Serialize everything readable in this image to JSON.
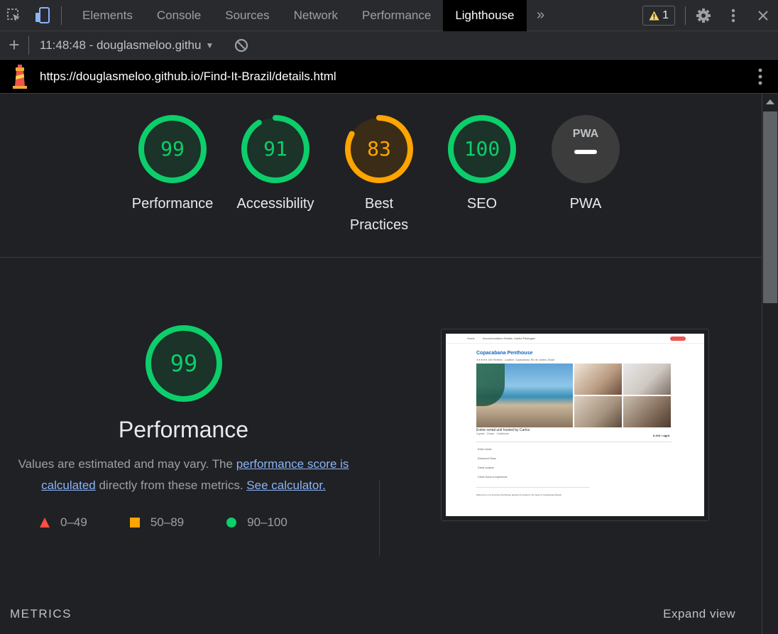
{
  "devtools": {
    "tabs": [
      "Elements",
      "Console",
      "Sources",
      "Network",
      "Performance",
      "Lighthouse"
    ],
    "active_tab": "Lighthouse",
    "warning_count": "1",
    "report_selector": "11:48:48 - douglasmeloo.githu",
    "url": "https://douglasmeloo.github.io/Find-It-Brazil/details.html"
  },
  "scores": [
    {
      "label": "Performance",
      "value": "99",
      "score": 99,
      "rating": "pass"
    },
    {
      "label": "Accessibility",
      "value": "91",
      "score": 91,
      "rating": "pass"
    },
    {
      "label": "Best Practices",
      "value": "83",
      "score": 83,
      "rating": "average"
    },
    {
      "label": "SEO",
      "value": "100",
      "score": 100,
      "rating": "pass"
    },
    {
      "label": "PWA",
      "value": "",
      "score": null,
      "rating": "na"
    }
  ],
  "pwa_badge": "PWA",
  "performance": {
    "score": "99",
    "title": "Performance",
    "desc_prefix": "Values are estimated and may vary. The ",
    "link_score": "performance score is calculated",
    "desc_middle": " directly from these metrics. ",
    "link_calc": "See calculator.",
    "legend": [
      "0–49",
      "50–89",
      "90–100"
    ]
  },
  "screenshot": {
    "nav": [
      "Home",
      "Accommodation Details",
      "Useful Packages"
    ],
    "title": "Copacabana Penthouse",
    "subtitle": "★★★★★ 160 Reviews · Location: Copacabana, Rio de Janeiro, Brazil",
    "caption": "Entire rental unit hosted by Carlos",
    "details": "4 guest · 2 beds · 1 bathroom",
    "price": "$ 200 / night",
    "features": [
      "Entire Home",
      "Enhanced Clean",
      "Great Location",
      "Great Check-in experience"
    ],
    "paragraph": "Welcome to our luxurious Penthouse apartment located in the heart of Copacabana Beach."
  },
  "sections": {
    "metrics": "METRICS",
    "expand": "Expand view"
  },
  "colors": {
    "pass": "#0cce6b",
    "pass_bg": "#1b3328",
    "average": "#ffa400",
    "average_bg": "#3a2c17",
    "fail": "#ff4e42",
    "na": "#3c3c3c"
  }
}
